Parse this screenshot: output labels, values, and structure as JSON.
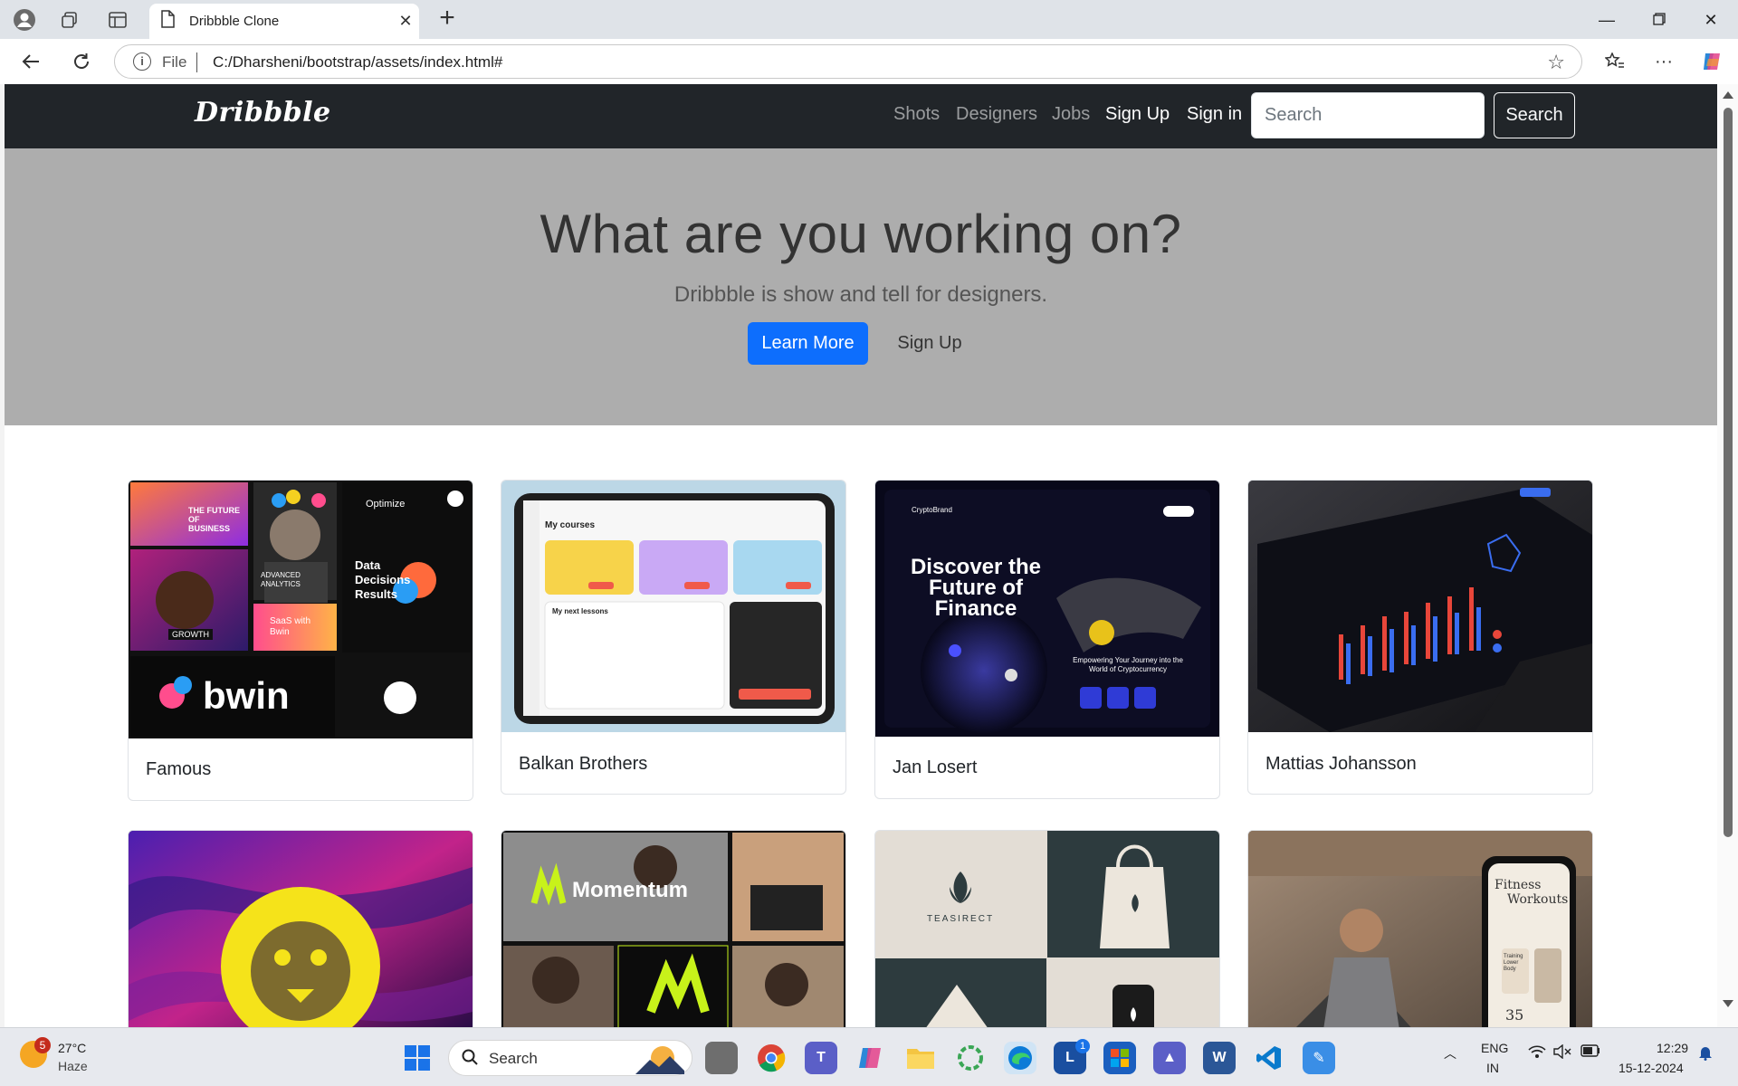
{
  "browser": {
    "tab_title": "Dribbble Clone",
    "address_scheme": "File",
    "address_url": "C:/Dharsheni/bootstrap/assets/index.html#"
  },
  "site": {
    "brand": "Dribbble",
    "nav": {
      "shots": "Shots",
      "designers": "Designers",
      "jobs": "Jobs",
      "signup": "Sign Up",
      "signin": "Sign in",
      "search_placeholder": "Search",
      "search_button": "Search"
    },
    "hero": {
      "title": "What are you working on?",
      "subtitle": "Dribbble is show and tell for designers.",
      "learn_more": "Learn More",
      "sign_up": "Sign Up"
    },
    "cards": [
      {
        "title": "Famous",
        "img": {
          "future": "THE FUTURE OF BUSINESS",
          "optimize": "Optimize",
          "analytics": "ADVANCED ANALYTICS",
          "data": "Data Decisions Results",
          "growth": "GROWTH",
          "saas": "SaaS with Bwin",
          "bwin": "bwin"
        }
      },
      {
        "title": "Balkan Brothers",
        "img": {
          "heading": "My courses",
          "lessons": "My next lessons"
        }
      },
      {
        "title": "Jan Losert",
        "img": {
          "brand": "CryptoBrand",
          "headline": "Discover the Future of Finance",
          "journey": "Empowering Your Journey into the World of Cryptocurrency"
        }
      },
      {
        "title": "Mattias Johansson",
        "img": {}
      },
      {
        "title": "",
        "img": {}
      },
      {
        "title": "",
        "img": {
          "brand": "Momentum"
        }
      },
      {
        "title": "",
        "img": {
          "brand": "TEASIRECT"
        }
      },
      {
        "title": "",
        "img": {
          "line1": "Fitness",
          "line2": "Workouts",
          "item": "Training Lower Body",
          "num": "35"
        }
      }
    ]
  },
  "taskbar": {
    "weather_temp": "27°C",
    "weather_cond": "Haze",
    "weather_badge": "5",
    "search_label": "Search",
    "lang_1": "ENG",
    "lang_2": "IN",
    "time": "12:29",
    "date": "15-12-2024",
    "teams_badge": "1"
  }
}
